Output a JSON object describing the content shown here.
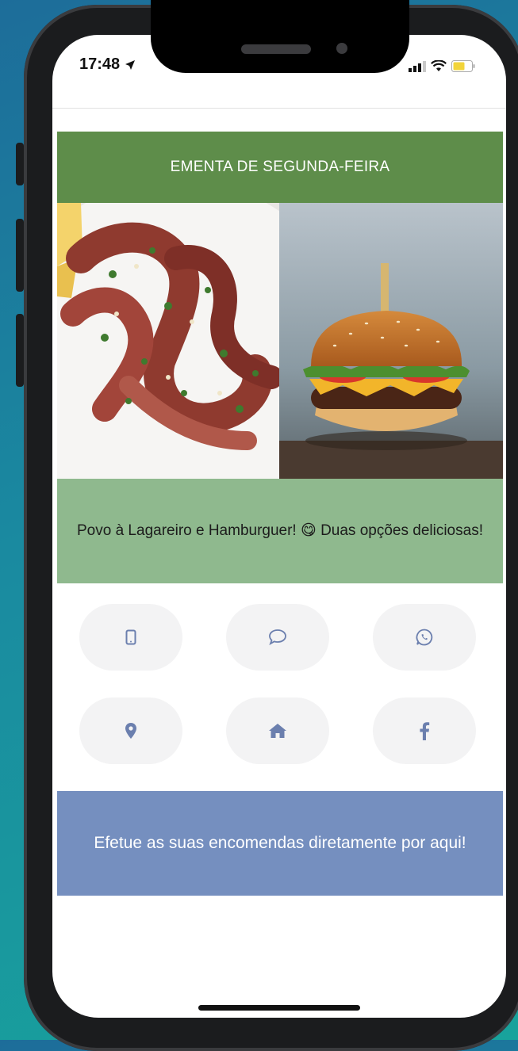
{
  "status_bar": {
    "time": "17:48"
  },
  "menu": {
    "title": "EMENTA DE SEGUNDA-FEIRA",
    "photos": [
      {
        "name": "octopus-photo",
        "icon": "grilled-octopus"
      },
      {
        "name": "burger-photo",
        "icon": "hamburger"
      }
    ],
    "caption": "Povo à Lagareiro e Hamburguer! 😋 Duas opções deliciosas!"
  },
  "contact_buttons": [
    {
      "name": "phone-button",
      "icon": "mobile-phone-icon"
    },
    {
      "name": "message-button",
      "icon": "chat-bubble-icon"
    },
    {
      "name": "whatsapp-button",
      "icon": "whatsapp-icon"
    },
    {
      "name": "location-button",
      "icon": "map-pin-icon"
    },
    {
      "name": "home-button",
      "icon": "home-icon"
    },
    {
      "name": "facebook-button",
      "icon": "facebook-icon"
    }
  ],
  "cta": {
    "text": "Efetue as suas encomendas diretamente por aqui!"
  },
  "colors": {
    "header_bg": "#5e8d4a",
    "caption_bg": "#8fb98e",
    "cta_bg": "#758fbf",
    "icon_color": "#6b7fae"
  }
}
